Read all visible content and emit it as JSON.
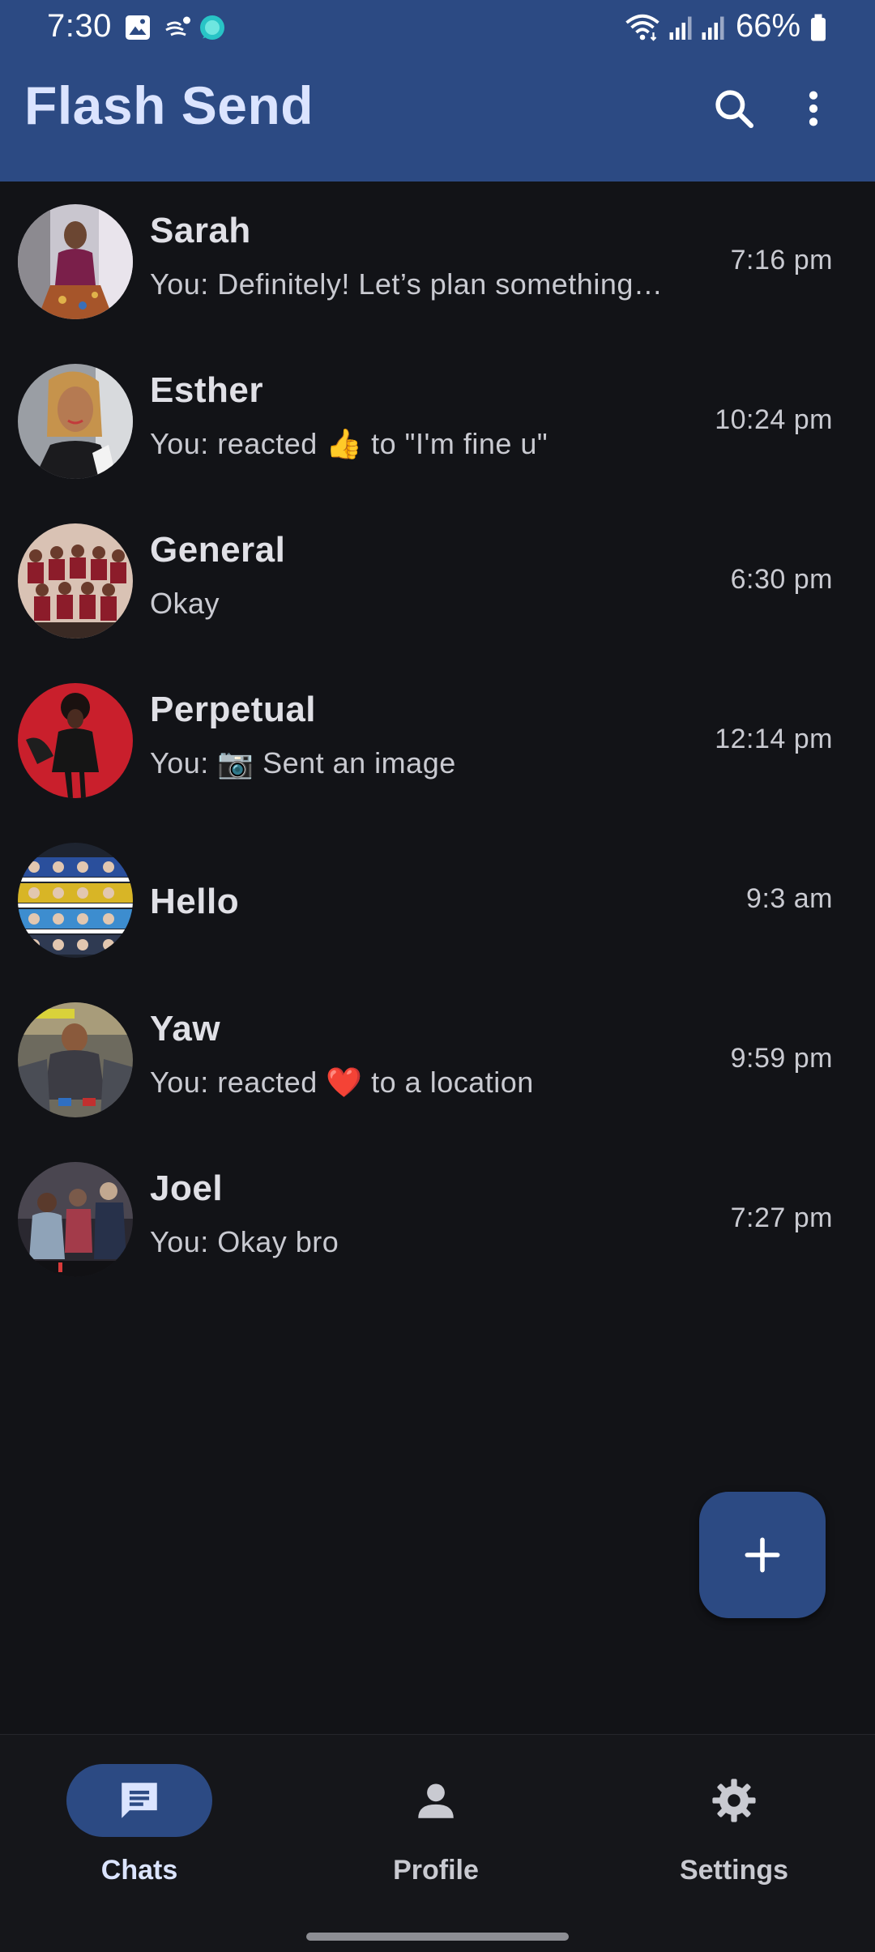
{
  "status_bar": {
    "time": "7:30",
    "battery": "66%",
    "icons": [
      "gallery-icon",
      "weather-icon",
      "app-notification-icon",
      "wifi-icon",
      "signal-icon",
      "signal-icon",
      "battery-icon"
    ]
  },
  "app_bar": {
    "title": "Flash Send",
    "actions": [
      "search-icon",
      "more-vert-icon"
    ]
  },
  "chats": [
    {
      "name": "Sarah",
      "preview": "You: Definitely! Let’s plan something…",
      "time": "7:16 pm",
      "avatar": "photo-person"
    },
    {
      "name": "Esther",
      "preview": "You: reacted 👍 to \"I'm fine u\"",
      "time": "10:24 pm",
      "avatar": "photo-person"
    },
    {
      "name": "General",
      "preview": "Okay",
      "time": "6:30 pm",
      "avatar": "photo-group"
    },
    {
      "name": "Perpetual",
      "preview": "You: 📷 Sent an image",
      "time": "12:14 pm",
      "avatar": "photo-person"
    },
    {
      "name": "Hello",
      "preview": "",
      "time": "9:3 am",
      "avatar": "photo-collage"
    },
    {
      "name": "Yaw",
      "preview": "You: reacted ❤️ to a location",
      "time": "9:59 pm",
      "avatar": "photo-game"
    },
    {
      "name": "Joel",
      "preview": "You: Okay bro",
      "time": "7:27 pm",
      "avatar": "photo-video"
    }
  ],
  "fab": {
    "icon": "plus-icon"
  },
  "bottom_nav": [
    {
      "label": "Chats",
      "icon": "chat-icon",
      "active": true
    },
    {
      "label": "Profile",
      "icon": "person-icon",
      "active": false
    },
    {
      "label": "Settings",
      "icon": "gear-icon",
      "active": false
    }
  ],
  "colors": {
    "primary": "#2c4a83",
    "background": "#121317",
    "title": "#dbe4ff",
    "text": "#e0e0e6",
    "muted": "#c9cad1"
  }
}
